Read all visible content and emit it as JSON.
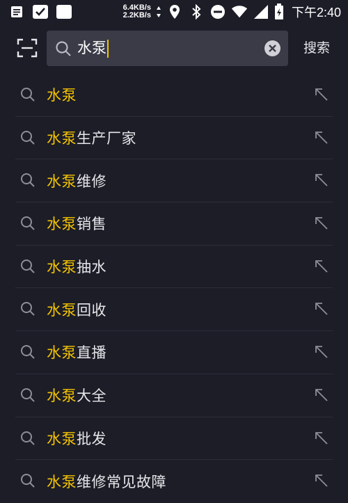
{
  "status_bar": {
    "icons_left": [
      "notes-icon",
      "checkbox-app-icon",
      "blank-app-icon"
    ],
    "net_up": "6.4KB/s",
    "net_down": "2.2KB/s",
    "icons_right": [
      "location-icon",
      "bluetooth-icon",
      "dnd-icon",
      "wifi-icon",
      "signal-icon",
      "battery-icon"
    ],
    "time": "下午2:40"
  },
  "search": {
    "query": "水泵",
    "submit_label": "搜索"
  },
  "suggestions": [
    {
      "highlight": "水泵",
      "rest": ""
    },
    {
      "highlight": "水泵",
      "rest": "生产厂家"
    },
    {
      "highlight": "水泵",
      "rest": "维修"
    },
    {
      "highlight": "水泵",
      "rest": "销售"
    },
    {
      "highlight": "水泵",
      "rest": "抽水"
    },
    {
      "highlight": "水泵",
      "rest": "回收"
    },
    {
      "highlight": "水泵",
      "rest": "直播"
    },
    {
      "highlight": "水泵",
      "rest": "大全"
    },
    {
      "highlight": "水泵",
      "rest": "批发"
    },
    {
      "highlight": "水泵",
      "rest": "维修常见故障"
    }
  ],
  "colors": {
    "background": "#1c1d27",
    "search_box": "#3a3b47",
    "highlight": "#f5c400",
    "divider": "#2c2d38"
  }
}
